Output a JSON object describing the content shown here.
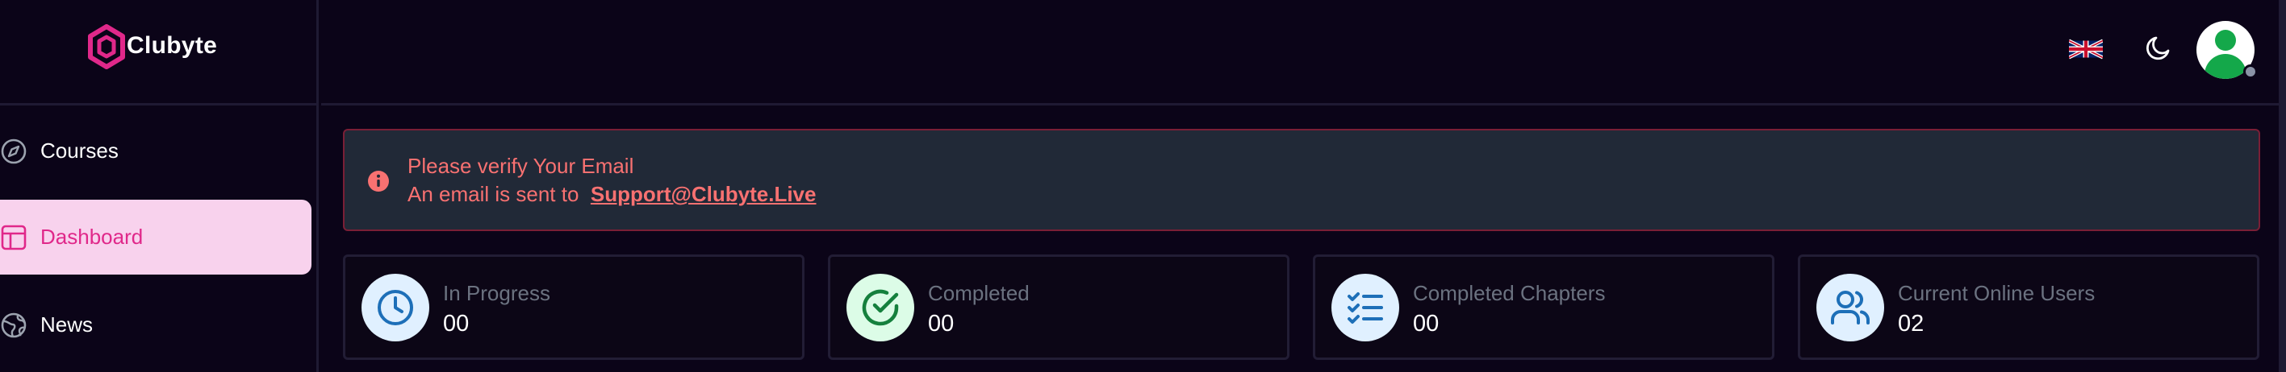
{
  "brand": {
    "name": "Clubyte"
  },
  "sidebar": {
    "items": [
      {
        "label": "Courses",
        "icon": "compass-icon",
        "active": false
      },
      {
        "label": "Dashboard",
        "icon": "layout-icon",
        "active": true
      },
      {
        "label": "News",
        "icon": "globe-icon",
        "active": false
      }
    ]
  },
  "header": {
    "language_icon": "uk-flag-icon",
    "theme_icon": "moon-icon",
    "avatar_icon": "user-avatar-icon",
    "avatar_status": "offline"
  },
  "alert": {
    "title": "Please verify Your Email",
    "message": "An email is sent to ",
    "email": "Support@Clubyte.Live",
    "icon": "info-icon"
  },
  "stats": [
    {
      "label": "In Progress",
      "value": "00",
      "icon": "clock-icon"
    },
    {
      "label": "Completed",
      "value": "00",
      "icon": "check-circle-icon"
    },
    {
      "label": "Completed Chapters",
      "value": "00",
      "icon": "list-checks-icon"
    },
    {
      "label": "Current Online Users",
      "value": "02",
      "icon": "users-icon"
    }
  ],
  "colors": {
    "background": "#0b0418",
    "accent": "#e0288a",
    "active_bg": "#f8d2ed",
    "alert_text": "#f87171",
    "icon_blue": "#1d6fb8",
    "icon_green": "#15803d"
  }
}
